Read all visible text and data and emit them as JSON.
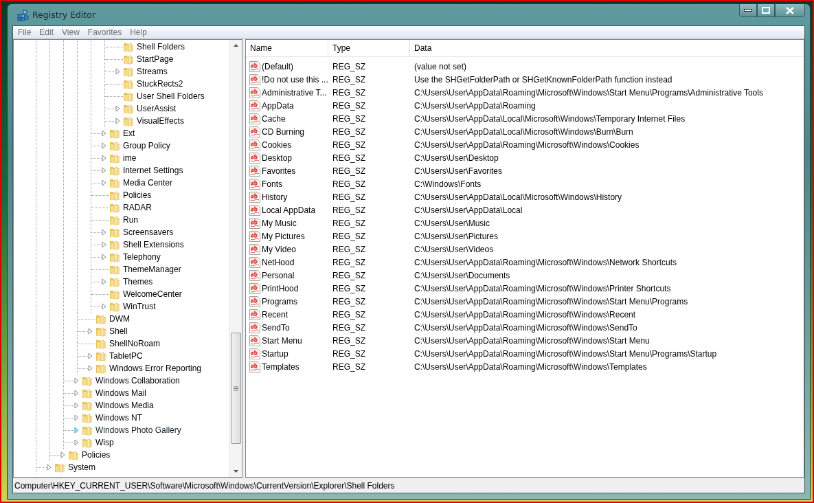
{
  "window": {
    "title": "Registry Editor"
  },
  "menu": [
    "File",
    "Edit",
    "View",
    "Favorites",
    "Help"
  ],
  "tree": {
    "items": [
      {
        "children": [
          {
            "children": [
              {
                "children": [
                  {
                    "children": [
                      {
                        "children": [
                          {
                            "label": "Shell Folders",
                            "expandable": false,
                            "hovered": false
                          },
                          {
                            "label": "StartPage",
                            "expandable": false,
                            "hovered": false
                          },
                          {
                            "label": "Streams",
                            "expandable": true,
                            "hovered": false
                          },
                          {
                            "label": "StuckRects2",
                            "expandable": false,
                            "hovered": false
                          },
                          {
                            "label": "User Shell Folders",
                            "expandable": false,
                            "hovered": false
                          },
                          {
                            "label": "UserAssist",
                            "expandable": true,
                            "hovered": false
                          },
                          {
                            "label": "VisualEffects",
                            "expandable": true,
                            "hovered": false
                          }
                        ]
                      },
                      {
                        "label": "Ext",
                        "expandable": true,
                        "hovered": false
                      },
                      {
                        "label": "Group Policy",
                        "expandable": true,
                        "hovered": false
                      },
                      {
                        "label": "ime",
                        "expandable": true,
                        "hovered": false
                      },
                      {
                        "label": "Internet Settings",
                        "expandable": true,
                        "hovered": false
                      },
                      {
                        "label": "Media Center",
                        "expandable": true,
                        "hovered": false
                      },
                      {
                        "label": "Policies",
                        "expandable": false,
                        "hovered": false
                      },
                      {
                        "label": "RADAR",
                        "expandable": false,
                        "hovered": false
                      },
                      {
                        "label": "Run",
                        "expandable": false,
                        "hovered": false
                      },
                      {
                        "label": "Screensavers",
                        "expandable": true,
                        "hovered": false
                      },
                      {
                        "label": "Shell Extensions",
                        "expandable": true,
                        "hovered": false
                      },
                      {
                        "label": "Telephony",
                        "expandable": true,
                        "hovered": false
                      },
                      {
                        "label": "ThemeManager",
                        "expandable": false,
                        "hovered": false
                      },
                      {
                        "label": "Themes",
                        "expandable": true,
                        "hovered": false
                      },
                      {
                        "label": "WelcomeCenter",
                        "expandable": false,
                        "hovered": false
                      },
                      {
                        "label": "WinTrust",
                        "expandable": true,
                        "hovered": false
                      }
                    ]
                  },
                  {
                    "label": "DWM",
                    "expandable": false,
                    "hovered": false
                  },
                  {
                    "label": "Shell",
                    "expandable": true,
                    "hovered": false
                  },
                  {
                    "label": "ShellNoRoam",
                    "expandable": false,
                    "hovered": false
                  },
                  {
                    "label": "TabletPC",
                    "expandable": true,
                    "hovered": false
                  },
                  {
                    "label": "Windows Error Reporting",
                    "expandable": true,
                    "hovered": false
                  }
                ]
              },
              {
                "label": "Windows Collaboration",
                "expandable": true,
                "hovered": false
              },
              {
                "label": "Windows Mail",
                "expandable": true,
                "hovered": false
              },
              {
                "label": "Windows Media",
                "expandable": true,
                "hovered": false
              },
              {
                "label": "Windows NT",
                "expandable": true,
                "hovered": false
              },
              {
                "label": "Windows Photo Gallery",
                "expandable": true,
                "hovered": true
              },
              {
                "label": "Wisp",
                "expandable": true,
                "hovered": false
              }
            ]
          },
          {
            "label": "Policies",
            "expandable": true,
            "hovered": false
          }
        ]
      },
      {
        "label": "System",
        "expandable": true,
        "hovered": false
      }
    ]
  },
  "values": {
    "columns": [
      "Name",
      "Type",
      "Data"
    ],
    "rows": [
      {
        "name": "(Default)",
        "type": "REG_SZ",
        "data": "(value not set)"
      },
      {
        "name": "!Do not use this ...",
        "type": "REG_SZ",
        "data": "Use the SHGetFolderPath or SHGetKnownFolderPath function instead"
      },
      {
        "name": "Administrative T...",
        "type": "REG_SZ",
        "data": "C:\\Users\\User\\AppData\\Roaming\\Microsoft\\Windows\\Start Menu\\Programs\\Administrative Tools"
      },
      {
        "name": "AppData",
        "type": "REG_SZ",
        "data": "C:\\Users\\User\\AppData\\Roaming"
      },
      {
        "name": "Cache",
        "type": "REG_SZ",
        "data": "C:\\Users\\User\\AppData\\Local\\Microsoft\\Windows\\Temporary Internet Files"
      },
      {
        "name": "CD Burning",
        "type": "REG_SZ",
        "data": "C:\\Users\\User\\AppData\\Local\\Microsoft\\Windows\\Burn\\Burn"
      },
      {
        "name": "Cookies",
        "type": "REG_SZ",
        "data": "C:\\Users\\User\\AppData\\Roaming\\Microsoft\\Windows\\Cookies"
      },
      {
        "name": "Desktop",
        "type": "REG_SZ",
        "data": "C:\\Users\\User\\Desktop"
      },
      {
        "name": "Favorites",
        "type": "REG_SZ",
        "data": "C:\\Users\\User\\Favorites"
      },
      {
        "name": "Fonts",
        "type": "REG_SZ",
        "data": "C:\\Windows\\Fonts"
      },
      {
        "name": "History",
        "type": "REG_SZ",
        "data": "C:\\Users\\User\\AppData\\Local\\Microsoft\\Windows\\History"
      },
      {
        "name": "Local AppData",
        "type": "REG_SZ",
        "data": "C:\\Users\\User\\AppData\\Local"
      },
      {
        "name": "My Music",
        "type": "REG_SZ",
        "data": "C:\\Users\\User\\Music"
      },
      {
        "name": "My Pictures",
        "type": "REG_SZ",
        "data": "C:\\Users\\User\\Pictures"
      },
      {
        "name": "My Video",
        "type": "REG_SZ",
        "data": "C:\\Users\\User\\Videos"
      },
      {
        "name": "NetHood",
        "type": "REG_SZ",
        "data": "C:\\Users\\User\\AppData\\Roaming\\Microsoft\\Windows\\Network Shortcuts"
      },
      {
        "name": "Personal",
        "type": "REG_SZ",
        "data": "C:\\Users\\User\\Documents"
      },
      {
        "name": "PrintHood",
        "type": "REG_SZ",
        "data": "C:\\Users\\User\\AppData\\Roaming\\Microsoft\\Windows\\Printer Shortcuts"
      },
      {
        "name": "Programs",
        "type": "REG_SZ",
        "data": "C:\\Users\\User\\AppData\\Roaming\\Microsoft\\Windows\\Start Menu\\Programs"
      },
      {
        "name": "Recent",
        "type": "REG_SZ",
        "data": "C:\\Users\\User\\AppData\\Roaming\\Microsoft\\Windows\\Recent"
      },
      {
        "name": "SendTo",
        "type": "REG_SZ",
        "data": "C:\\Users\\User\\AppData\\Roaming\\Microsoft\\Windows\\SendTo"
      },
      {
        "name": "Start Menu",
        "type": "REG_SZ",
        "data": "C:\\Users\\User\\AppData\\Roaming\\Microsoft\\Windows\\Start Menu"
      },
      {
        "name": "Startup",
        "type": "REG_SZ",
        "data": "C:\\Users\\User\\AppData\\Roaming\\Microsoft\\Windows\\Start Menu\\Programs\\Startup"
      },
      {
        "name": "Templates",
        "type": "REG_SZ",
        "data": "C:\\Users\\User\\AppData\\Roaming\\Microsoft\\Windows\\Templates"
      }
    ]
  },
  "status_bar": "Computer\\HKEY_CURRENT_USER\\Software\\Microsoft\\Windows\\CurrentVersion\\Explorer\\Shell Folders"
}
